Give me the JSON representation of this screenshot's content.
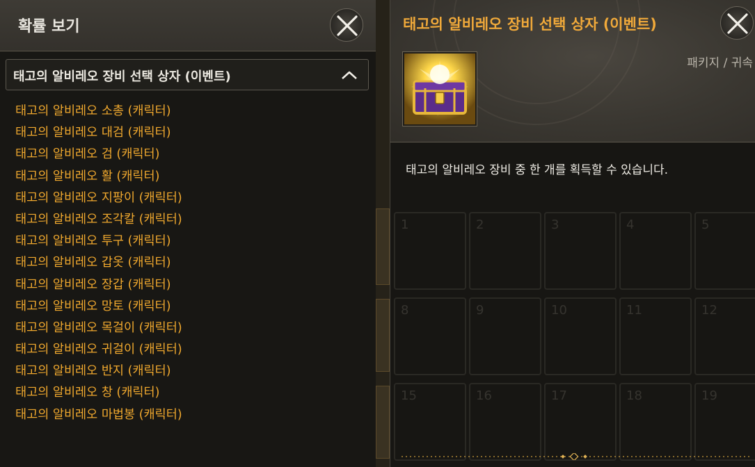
{
  "left_panel": {
    "title": "확률 보기",
    "dropdown": {
      "selected": "태고의 알비레오 장비 선택 상자 (이벤트)",
      "chevron_icon": "chevron-up-icon"
    },
    "items": [
      "태고의 알비레오 소총 (캐릭터)",
      "태고의 알비레오 대검 (캐릭터)",
      "태고의 알비레오 검 (캐릭터)",
      "태고의 알비레오 활 (캐릭터)",
      "태고의 알비레오 지팡이 (캐릭터)",
      "태고의 알비레오 조각칼 (캐릭터)",
      "태고의 알비레오 투구 (캐릭터)",
      "태고의 알비레오 갑옷 (캐릭터)",
      "태고의 알비레오 장갑 (캐릭터)",
      "태고의 알비레오 망토 (캐릭터)",
      "태고의 알비레오 목걸이 (캐릭터)",
      "태고의 알비레오 귀걸이 (캐릭터)",
      "태고의 알비레오 반지 (캐릭터)",
      "태고의 알비레오 창 (캐릭터)",
      "태고의 알비레오 마법봉 (캐릭터)"
    ],
    "close_icon": "close-icon"
  },
  "right_panel": {
    "title": "태고의 알비레오 장비 선택 상자 (이벤트)",
    "category": "패키지 / 귀속",
    "description": "태고의 알비레오 장비 중 한 개를 획득할 수 있습니다.",
    "icon": "treasure-chest-icon",
    "close_icon": "close-icon",
    "background_slots": [
      "1",
      "2",
      "3",
      "4",
      "5",
      "8",
      "9",
      "10",
      "11",
      "12",
      "15",
      "16",
      "17",
      "18",
      "19"
    ]
  },
  "colors": {
    "item_text": "#f1a92e",
    "title_text": "#f0a93a",
    "panel_bg": "#181714",
    "header_bg": "#3e3b35"
  }
}
